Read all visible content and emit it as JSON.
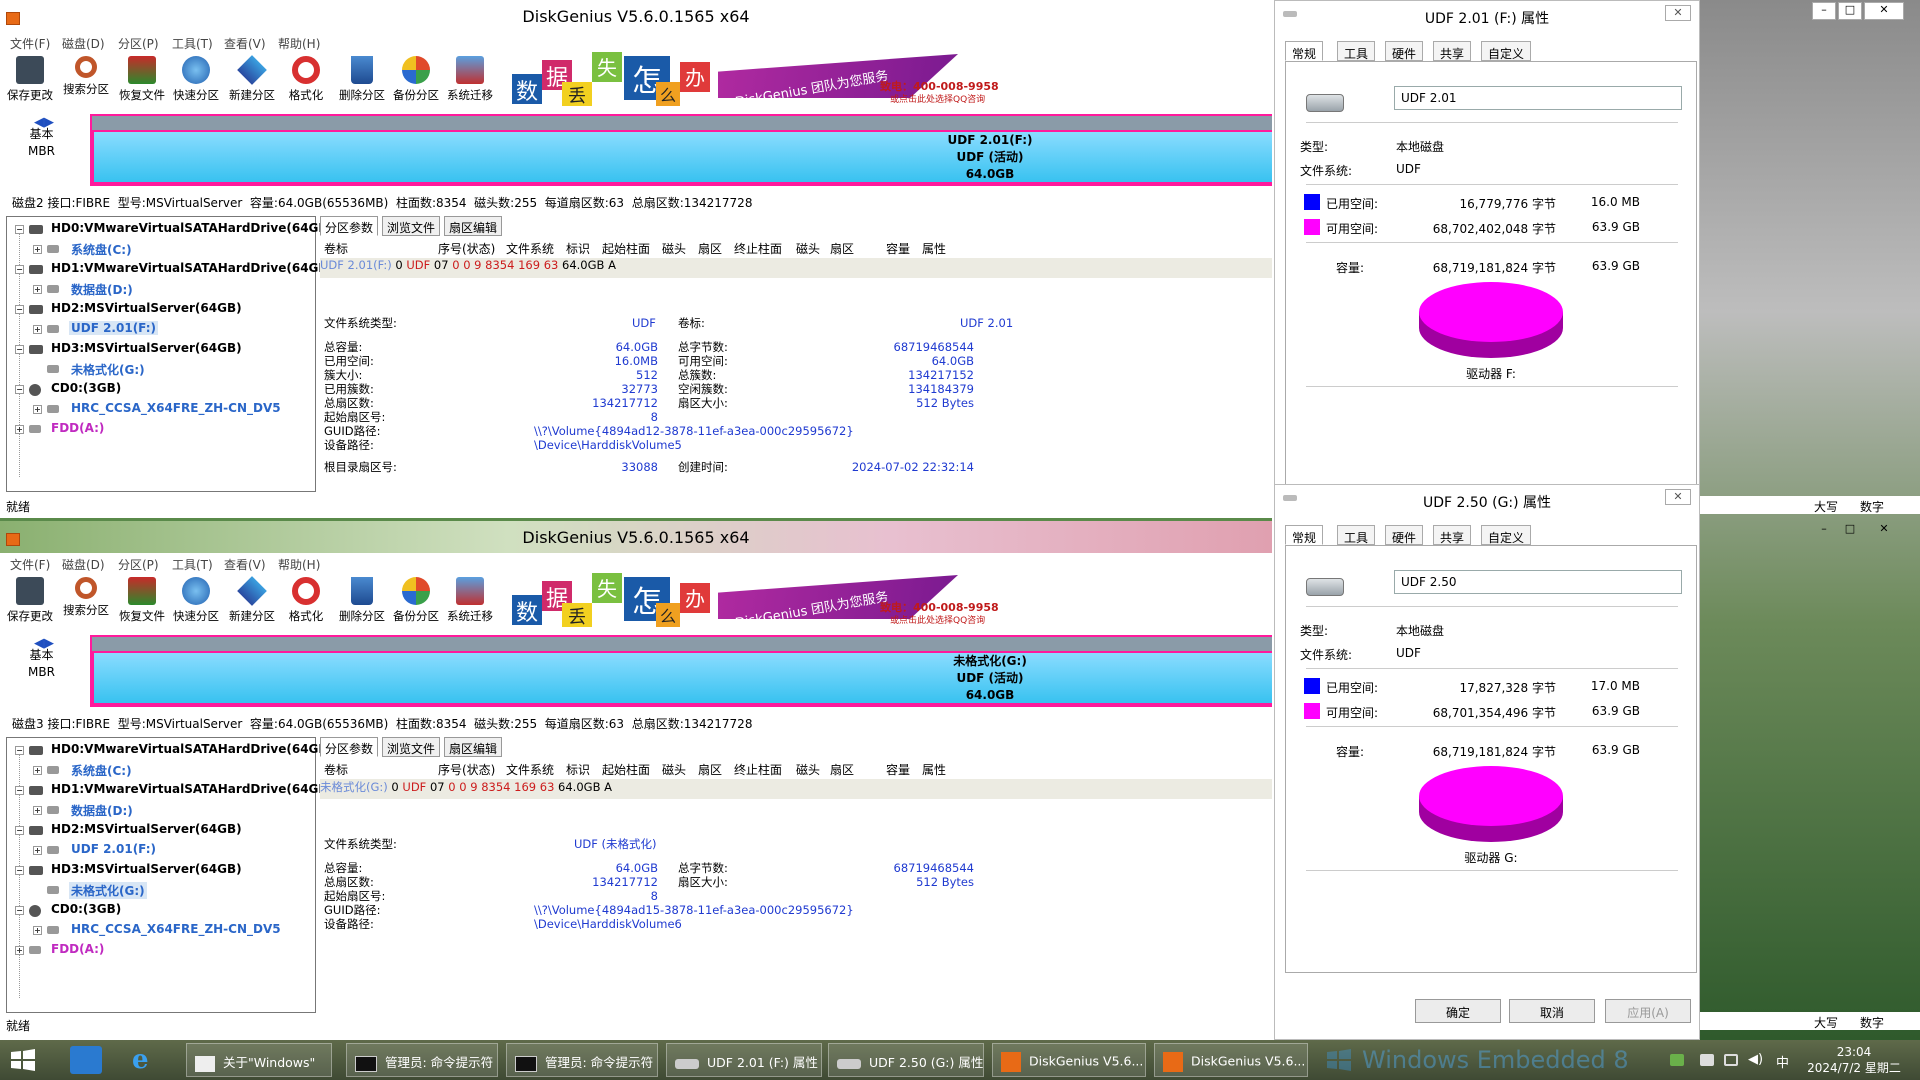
{
  "menu": [
    "文件(F)",
    "磁盘(D)",
    "分区(P)",
    "工具(T)",
    "查看(V)",
    "帮助(H)"
  ],
  "toolbar": [
    "保存更改",
    "搜索分区",
    "恢复文件",
    "快速分区",
    "新建分区",
    "格式化",
    "删除分区",
    "备份分区",
    "系统迁移"
  ],
  "ad": {
    "chars": [
      "数",
      "据",
      "丢",
      "失",
      "怎",
      "么",
      "办"
    ],
    "slogan": "DiskGenius 团队为您服务",
    "phone": "致电：400-008-9958",
    "qq": "或点击此处选择QQ咨询"
  },
  "disk_label": {
    "line1": "基本",
    "line2": "MBR"
  },
  "tabs": [
    "分区参数",
    "浏览文件",
    "扇区编辑"
  ],
  "table_headers": [
    "卷标",
    "序号(状态)",
    "文件系统",
    "标识",
    "起始柱面",
    "磁头",
    "扇区",
    "终止柱面",
    "磁头",
    "扇区",
    "容量",
    "属性"
  ],
  "tree_items": [
    "HD0:VMwareVirtualSATAHardDrive(64GB)",
    "系统盘(C:)",
    "HD1:VMwareVirtualSATAHardDrive(64GB)",
    "数据盘(D:)",
    "HD2:MSVirtualServer(64GB)",
    "UDF 2.01(F:)",
    "HD3:MSVirtualServer(64GB)",
    "未格式化(G:)",
    "CD0:(3GB)",
    "HRC_CCSA_X64FRE_ZH-CN_DV5",
    "FDD(A:)"
  ],
  "status_left": "就绪",
  "status_right": [
    "大写",
    "数字"
  ],
  "window1": {
    "title": "DiskGenius V5.6.0.1565 x64",
    "partition_bar": {
      "line1": "UDF 2.01(F:)",
      "line2": "UDF (活动)",
      "line3": "64.0GB"
    },
    "disk_info": "磁盘2 接口:FIBRE  型号:MSVirtualServer  容量:64.0GB(65536MB)  柱面数:8354  磁头数:255  每道扇区数:63  总扇区数:134217728",
    "row": [
      "UDF 2.01(F:)",
      "0",
      "UDF",
      "07",
      "0",
      "0",
      "9",
      "8354",
      "169",
      "63",
      "64.0GB",
      "A"
    ],
    "fs": {
      "type_label": "文件系统类型:",
      "type_value": "UDF",
      "vol_label": "卷标:",
      "vol_value": "UDF 2.01",
      "left": [
        [
          "总容量:",
          "64.0GB"
        ],
        [
          "已用空间:",
          "16.0MB"
        ],
        [
          "簇大小:",
          "512"
        ],
        [
          "已用簇数:",
          "32773"
        ],
        [
          "总扇区数:",
          "134217712"
        ],
        [
          "起始扇区号:",
          "8"
        ]
      ],
      "right": [
        [
          "总字节数:",
          "68719468544"
        ],
        [
          "可用空间:",
          "64.0GB"
        ],
        [
          "总簇数:",
          "134217152"
        ],
        [
          "空闲簇数:",
          "134184379"
        ],
        [
          "扇区大小:",
          "512 Bytes"
        ]
      ],
      "guid_label": "GUID路径:",
      "guid": "\\\\?\\Volume{4894ad12-3878-11ef-a3ea-000c29595672}",
      "dev_label": "设备路径:",
      "dev": "\\Device\\HarddiskVolume5",
      "root_label": "根目录扇区号:",
      "root": "33088",
      "ctime_label": "创建时间:",
      "ctime": "2024-07-02 22:32:14"
    }
  },
  "window2": {
    "title": "DiskGenius V5.6.0.1565 x64",
    "partition_bar": {
      "line1": "未格式化(G:)",
      "line2": "UDF (活动)",
      "line3": "64.0GB"
    },
    "disk_info": "磁盘3 接口:FIBRE  型号:MSVirtualServer  容量:64.0GB(65536MB)  柱面数:8354  磁头数:255  每道扇区数:63  总扇区数:134217728",
    "row": [
      "未格式化(G:)",
      "0",
      "UDF",
      "07",
      "0",
      "0",
      "9",
      "8354",
      "169",
      "63",
      "64.0GB",
      "A"
    ],
    "fs": {
      "type_label": "文件系统类型:",
      "type_value": "UDF (未格式化)",
      "left": [
        [
          "总容量:",
          "64.0GB"
        ],
        [
          "总扇区数:",
          "134217712"
        ],
        [
          "起始扇区号:",
          "8"
        ]
      ],
      "right": [
        [
          "总字节数:",
          "68719468544"
        ],
        [
          "扇区大小:",
          "512 Bytes"
        ]
      ],
      "guid_label": "GUID路径:",
      "guid": "\\\\?\\Volume{4894ad15-3878-11ef-a3ea-000c29595672}",
      "dev_label": "设备路径:",
      "dev": "\\Device\\HarddiskVolume6"
    }
  },
  "dialog_tabs": [
    "常规",
    "工具",
    "硬件",
    "共享",
    "自定义"
  ],
  "dialog1": {
    "title": "UDF 2.01 (F:) 属性",
    "name": "UDF 2.01",
    "type_label": "类型:",
    "type_value": "本地磁盘",
    "fs_label": "文件系统:",
    "fs_value": "UDF",
    "used_label": "已用空间:",
    "used_bytes": "16,779,776 字节",
    "used_size": "16.0 MB",
    "free_label": "可用空间:",
    "free_bytes": "68,702,402,048 字节",
    "free_size": "63.9 GB",
    "cap_label": "容量:",
    "cap_bytes": "68,719,181,824 字节",
    "cap_size": "63.9 GB",
    "drive": "驱动器 F:",
    "used_fraction": 0.0002
  },
  "dialog2": {
    "title": "UDF 2.50 (G:) 属性",
    "name": "UDF 2.50",
    "type_label": "类型:",
    "type_value": "本地磁盘",
    "fs_label": "文件系统:",
    "fs_value": "UDF",
    "used_label": "已用空间:",
    "used_bytes": "17,827,328 字节",
    "used_size": "17.0 MB",
    "free_label": "可用空间:",
    "free_bytes": "68,701,354,496 字节",
    "free_size": "63.9 GB",
    "cap_label": "容量:",
    "cap_bytes": "68,719,181,824 字节",
    "cap_size": "63.9 GB",
    "drive": "驱动器 G:",
    "used_fraction": 0.0003,
    "buttons": [
      "确定",
      "取消",
      "应用(A)"
    ]
  },
  "colors": {
    "used": "#0000ff",
    "free": "#ff00ff",
    "partition_border": "#ff1a9c",
    "partition_fill": "#38c2f0"
  },
  "taskbar": {
    "items": [
      "关于\"Windows\"",
      "管理员: 命令提示符",
      "管理员: 命令提示符",
      "UDF 2.01 (F:) 属性",
      "UDF 2.50 (G:) 属性",
      "DiskGenius V5.6...",
      "DiskGenius V5.6..."
    ],
    "brand": "Windows Embedded 8",
    "ime": "中",
    "time": "23:04",
    "date": "2024/7/2 星期二"
  }
}
